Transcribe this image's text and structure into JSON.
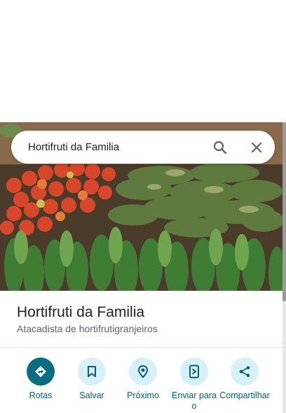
{
  "search": {
    "query": "Hortifruti da Familia"
  },
  "place": {
    "name": "Hortifruti da Familia",
    "category": "Atacadista de hortifrutigranjeiros"
  },
  "actions": [
    {
      "label": "Rotas",
      "icon": "directions-icon"
    },
    {
      "label": "Salvar",
      "icon": "bookmark-icon"
    },
    {
      "label": "Próximo",
      "icon": "nearby-icon"
    },
    {
      "label": "Enviar para o",
      "icon": "send-to-phone-icon"
    },
    {
      "label": "Compartilhar",
      "icon": "share-icon"
    }
  ],
  "colors": {
    "accent": "#0b6e80",
    "action_bg": "#d7f1f8",
    "label": "#0b5f6e"
  }
}
